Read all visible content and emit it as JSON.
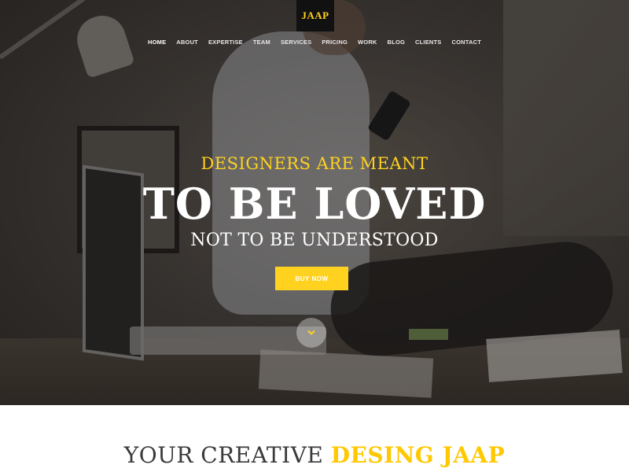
{
  "brand": {
    "logo_text": "JAAP"
  },
  "nav": {
    "items": [
      {
        "label": "HOME",
        "active": true
      },
      {
        "label": "ABOUT"
      },
      {
        "label": "EXPERTISE"
      },
      {
        "label": "TEAM"
      },
      {
        "label": "SERVICES"
      },
      {
        "label": "PRICING"
      },
      {
        "label": "WORK"
      },
      {
        "label": "BLOG"
      },
      {
        "label": "CLIENTS"
      },
      {
        "label": "CONTACT"
      }
    ]
  },
  "hero": {
    "tagline_top": "DESIGNERS ARE MEANT",
    "headline": "TO BE LOVED",
    "tagline_bottom": "NOT TO BE UNDERSTOOD",
    "cta_label": "BUY NOW",
    "scroll_icon": "chevron-down-icon"
  },
  "section": {
    "title_prefix": "YOUR CREATIVE",
    "title_accent": "DESING JAAP"
  },
  "colors": {
    "accent": "#ffd21f",
    "brand_bg": "#111111",
    "title_text": "#3a3a3a"
  }
}
